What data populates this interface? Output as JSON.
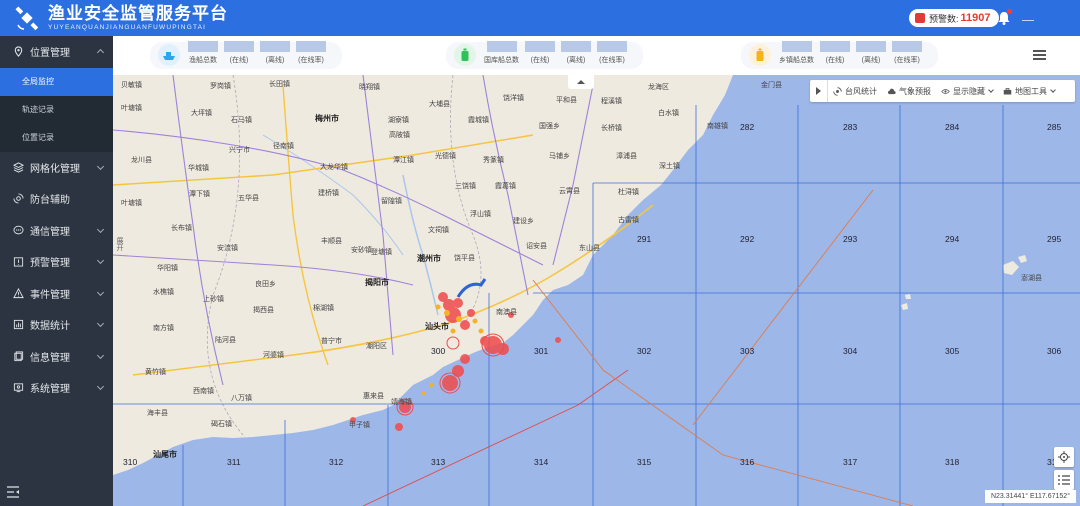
{
  "header": {
    "title": "渔业安全监管服务平台",
    "subtitle": "YUYEANQUANJIANGUANFUWUPINGTAI",
    "alert_label": "预警数:",
    "alert_count": "11907"
  },
  "sidebar": {
    "items": [
      {
        "label": "位置管理",
        "icon": "location-icon",
        "expanded": true,
        "children": [
          {
            "label": "全局监控",
            "active": true
          },
          {
            "label": "轨迹记录",
            "active": false
          },
          {
            "label": "位置记录",
            "active": false
          }
        ]
      },
      {
        "label": "网格化管理",
        "icon": "layers-icon"
      },
      {
        "label": "防台辅助",
        "icon": "typhoon-icon"
      },
      {
        "label": "通信管理",
        "icon": "chat-icon"
      },
      {
        "label": "预警管理",
        "icon": "warning-icon"
      },
      {
        "label": "事件管理",
        "icon": "event-icon"
      },
      {
        "label": "数据统计",
        "icon": "chart-icon"
      },
      {
        "label": "信息管理",
        "icon": "info-icon"
      },
      {
        "label": "系统管理",
        "icon": "system-icon"
      }
    ]
  },
  "stats": {
    "groups": [
      {
        "name": "fishing",
        "icon": "ship-icon",
        "color": "#29a7f0",
        "labels": [
          "渔船总数",
          "(在线)",
          "(离线)",
          "(在线率)"
        ]
      },
      {
        "name": "domestic",
        "icon": "bottle-icon",
        "color": "#2fc25b",
        "labels": [
          "国库船总数",
          "(在线)",
          "(离线)",
          "(在线率)"
        ]
      },
      {
        "name": "township",
        "icon": "bottle-icon",
        "color": "#f6b21a",
        "labels": [
          "乡镇船总数",
          "(在线)",
          "(离线)",
          "(在线率)"
        ]
      }
    ]
  },
  "map": {
    "tools": {
      "typhoon": "台风统计",
      "weather": "气象预报",
      "display": "显示隐藏",
      "maptool": "地图工具"
    },
    "expand_label": "展开",
    "coords": "N23.31441°   E117.67152°",
    "grid_numbers": [
      "282",
      "283",
      "284",
      "285",
      "291",
      "292",
      "293",
      "294",
      "295",
      "300",
      "301",
      "302",
      "303",
      "304",
      "305",
      "306",
      "310",
      "311",
      "312",
      "313",
      "314",
      "315",
      "316",
      "317",
      "318",
      "31"
    ],
    "places": [
      {
        "t": "贝敏镇"
      },
      {
        "t": "罗岗镇"
      },
      {
        "t": "长田镇"
      },
      {
        "t": "晓翔镇"
      },
      {
        "t": "大埔县"
      },
      {
        "t": "饶洋镇"
      },
      {
        "t": "平和县"
      },
      {
        "t": "程溪镇"
      },
      {
        "t": "龙海区"
      },
      {
        "t": "金门县"
      },
      {
        "t": "叶塘镇"
      },
      {
        "t": "大坪镇"
      },
      {
        "t": "石马镇"
      },
      {
        "t": "梅州市",
        "city": true
      },
      {
        "t": "湖寮镇"
      },
      {
        "t": "霞城镇"
      },
      {
        "t": "国强乡"
      },
      {
        "t": "长桥镇"
      },
      {
        "t": "白水镇"
      },
      {
        "t": "南雄镇"
      },
      {
        "t": "兴宁市"
      },
      {
        "t": "径南镇"
      },
      {
        "t": "高陂镇"
      },
      {
        "t": "马铺乡"
      },
      {
        "t": "漳浦县"
      },
      {
        "t": "龙川县"
      },
      {
        "t": "大龙华镇"
      },
      {
        "t": "潭江镇"
      },
      {
        "t": "光德镇"
      },
      {
        "t": "秀篆镇"
      },
      {
        "t": "深土镇"
      },
      {
        "t": "华城镇"
      },
      {
        "t": "五华县"
      },
      {
        "t": "建桥镇"
      },
      {
        "t": "三饶镇"
      },
      {
        "t": "霞葛镇"
      },
      {
        "t": "云霄县"
      },
      {
        "t": "杜浔镇"
      },
      {
        "t": "叶塘镇"
      },
      {
        "t": "潭下镇"
      },
      {
        "t": "留隍镇"
      },
      {
        "t": "浮山镇"
      },
      {
        "t": "古雷镇"
      },
      {
        "t": "长布镇"
      },
      {
        "t": "丰顺县"
      },
      {
        "t": "文祠镇"
      },
      {
        "t": "建设乡"
      },
      {
        "t": "安砂镇"
      },
      {
        "t": "安流镇"
      },
      {
        "t": "登塘镇"
      },
      {
        "t": "诏安县"
      },
      {
        "t": "东山县"
      },
      {
        "t": "华阳镇"
      },
      {
        "t": "潮州市",
        "city": true
      },
      {
        "t": "饶平县"
      },
      {
        "t": "水樵镇"
      },
      {
        "t": "揭阳市",
        "city": true
      },
      {
        "t": "南澳县"
      },
      {
        "t": "上砂镇"
      },
      {
        "t": "良田乡"
      },
      {
        "t": "南方镇"
      },
      {
        "t": "揭西县"
      },
      {
        "t": "棉湖镇"
      },
      {
        "t": "汕头市",
        "city": true
      },
      {
        "t": "陆河县"
      },
      {
        "t": "普宁市"
      },
      {
        "t": "潮阳区"
      },
      {
        "t": "河婆镇"
      },
      {
        "t": "黄竹镇"
      },
      {
        "t": "西南镇"
      },
      {
        "t": "惠来县"
      },
      {
        "t": "八万镇"
      },
      {
        "t": "海丰县"
      },
      {
        "t": "汕尾市",
        "city": true
      },
      {
        "t": "碣石镇"
      },
      {
        "t": "甲子镇"
      },
      {
        "t": "靖海镇"
      },
      {
        "t": "澎湖县"
      }
    ]
  }
}
